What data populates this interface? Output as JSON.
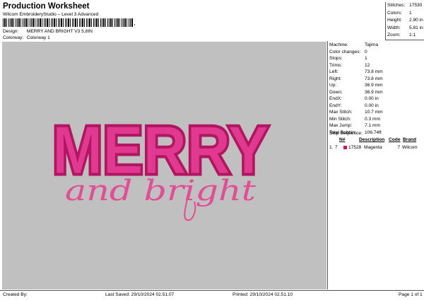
{
  "header": {
    "title": "Production Worksheet",
    "subtitle": "Wilcom EmbroideryStudio – Level 3 Advanced",
    "barcode_tail": ","
  },
  "info": [
    {
      "label": "Design:",
      "value": "MERRY AND BRIGHT V3 5,8IN"
    },
    {
      "label": "Colorway:",
      "value": "Colorway 1"
    }
  ],
  "stats": [
    {
      "label": "Stitches:",
      "value": "17530"
    },
    {
      "label": "Colors:",
      "value": "1"
    },
    {
      "label": "Height:",
      "value": "2.90 in"
    },
    {
      "label": "Width:",
      "value": "5.81 in"
    },
    {
      "label": "Zoom:",
      "value": "1:1"
    }
  ],
  "machine_params": [
    {
      "label": "Machine:",
      "value": "Tajima"
    },
    {
      "label": "Color changes:",
      "value": "0"
    },
    {
      "label": "Stops:",
      "value": "1"
    },
    {
      "label": "Trims:",
      "value": "12"
    },
    {
      "label": "Left:",
      "value": "73.8 mm"
    },
    {
      "label": "Right:",
      "value": "73.8 mm"
    },
    {
      "label": "Up:",
      "value": "36.9 mm"
    },
    {
      "label": "Down:",
      "value": "36.9 mm"
    },
    {
      "label": "EndX:",
      "value": "0.00 in"
    },
    {
      "label": "EndY:",
      "value": "0.00 in"
    },
    {
      "label": "Max Stitch:",
      "value": "10.7 mm"
    },
    {
      "label": "Min Stitch:",
      "value": "0.3 mm"
    },
    {
      "label": "Max Jump:",
      "value": "7.1 mm"
    },
    {
      "label": "Total Bobbin:",
      "value": "106.74ft"
    }
  ],
  "stop_sequence": {
    "title": "Stop Sequence:",
    "headers": {
      "num": "N#",
      "description": "Description",
      "code": "Code",
      "brand": "Brand"
    },
    "rows": [
      {
        "index": "1.",
        "stop": "7",
        "number": "17528",
        "description": "Magenta",
        "code": "7",
        "brand": "Wilcom",
        "color": "#d6106b"
      }
    ]
  },
  "design": {
    "line1": "MERRY",
    "line2": "and bright",
    "fill_color": "#e0398f",
    "outline_color": "#b11761",
    "script_color": "#e34c97",
    "background": "#c0c0c0"
  },
  "footer": {
    "created_by": "Created By:",
    "last_saved": "Last Saved: 29/10/2024 02.51.07",
    "printed": "Printed: 29/10/2024 02.51.10",
    "page": "Page 1 of 1"
  }
}
